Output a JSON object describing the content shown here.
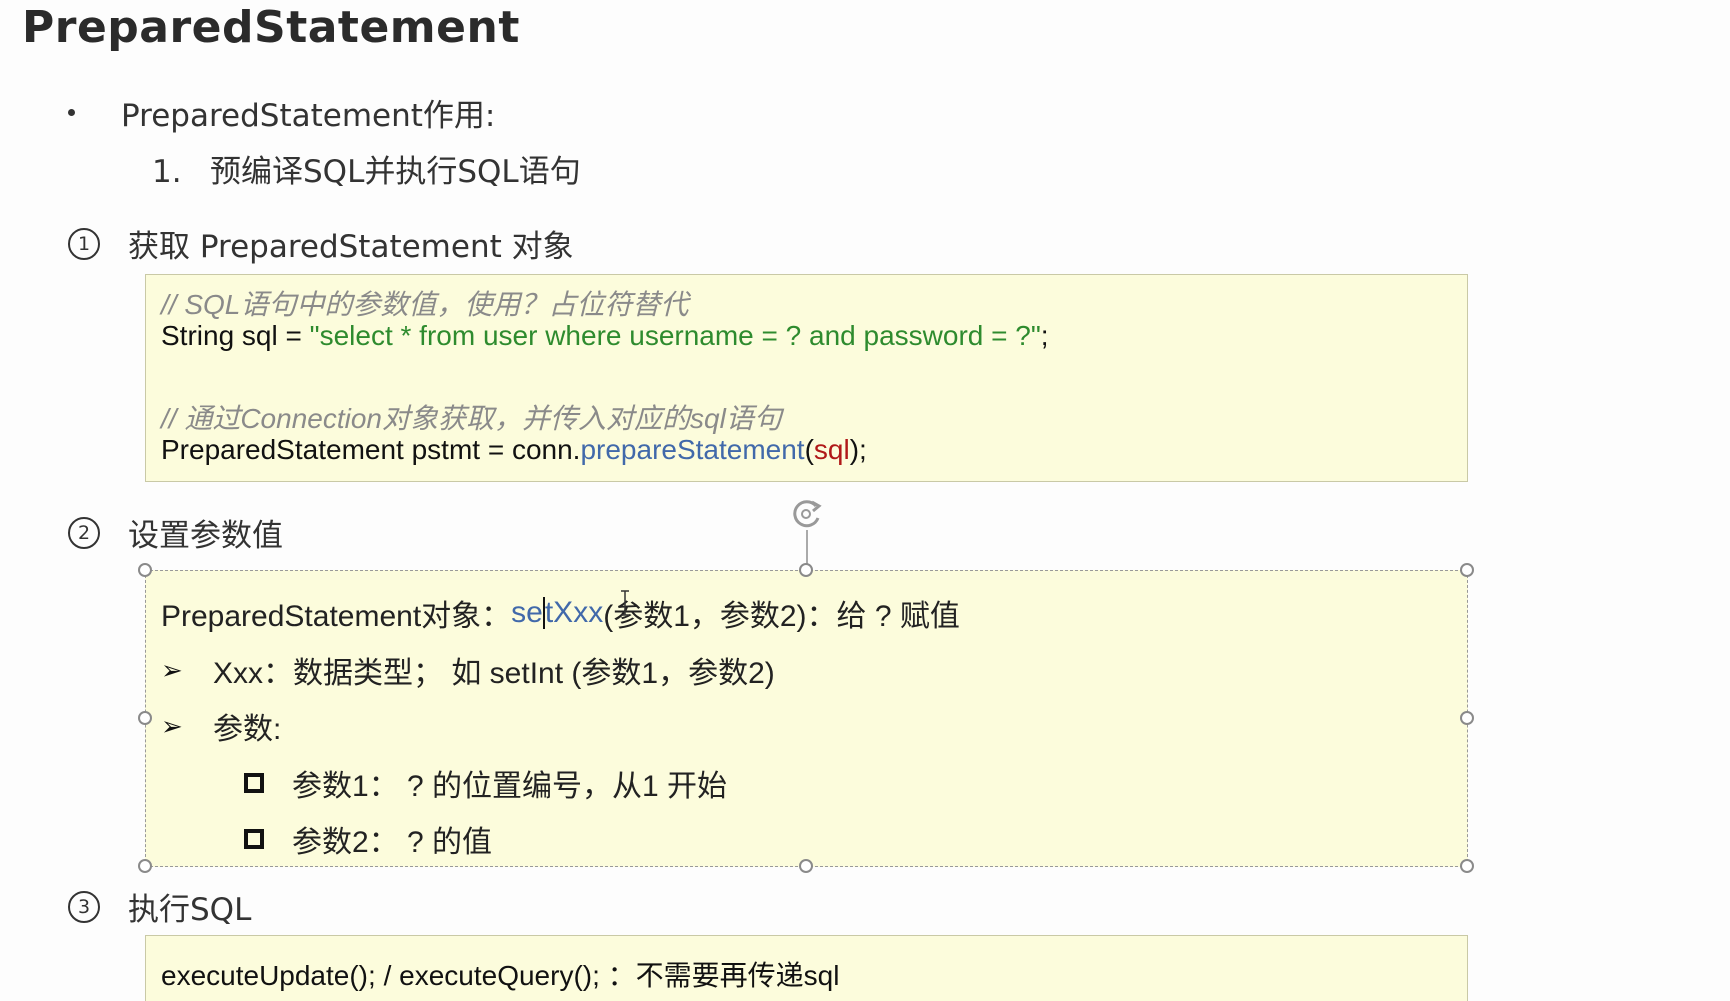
{
  "title": "PreparedStatement",
  "bullet": "PreparedStatement作用:",
  "numbered": {
    "num": "1.",
    "text": "预编译SQL并执行SQL语句"
  },
  "sections": {
    "s1": {
      "marker": "1",
      "heading": "获取 PreparedStatement 对象",
      "lines": {
        "comment1": "// SQL语句中的参数值，使用？占位符替代",
        "code1_prefix": "String sql = ",
        "code1_string": "\"select * from user where username = ? and password = ?\"",
        "code1_suffix": ";",
        "comment2": "// 通过Connection对象获取，并传入对应的sql语句",
        "code2_prefix": "PreparedStatement pstmt = conn.",
        "code2_method": "prepareStatement",
        "code2_open": "(",
        "code2_arg": "sql",
        "code2_close": ");"
      }
    },
    "s2": {
      "marker": "2",
      "heading": "设置参数值",
      "lines": {
        "l1_prefix": "PreparedStatement对象：",
        "l1_method_a": "se",
        "l1_method_b": "tXxx",
        "l1_suffix": "(参数1，参数2)：给 ? 赋值",
        "l2": "Xxx：数据类型； 如 setInt (参数1，参数2)",
        "l3": "参数:",
        "l4": "参数1： ? 的位置编号，从1 开始",
        "l5": "参数2： ? 的值"
      },
      "arrow_glyph": "➢"
    },
    "s3": {
      "marker": "3",
      "heading": "执行SQL",
      "line": "executeUpdate(); / executeQuery();  ：不需要再传递sql"
    }
  },
  "colors": {
    "box_background": "#fcfcdc",
    "comment": "#8a8a8a",
    "string": "#2e8b2e",
    "method": "#4169aa",
    "argument": "#b01818"
  }
}
